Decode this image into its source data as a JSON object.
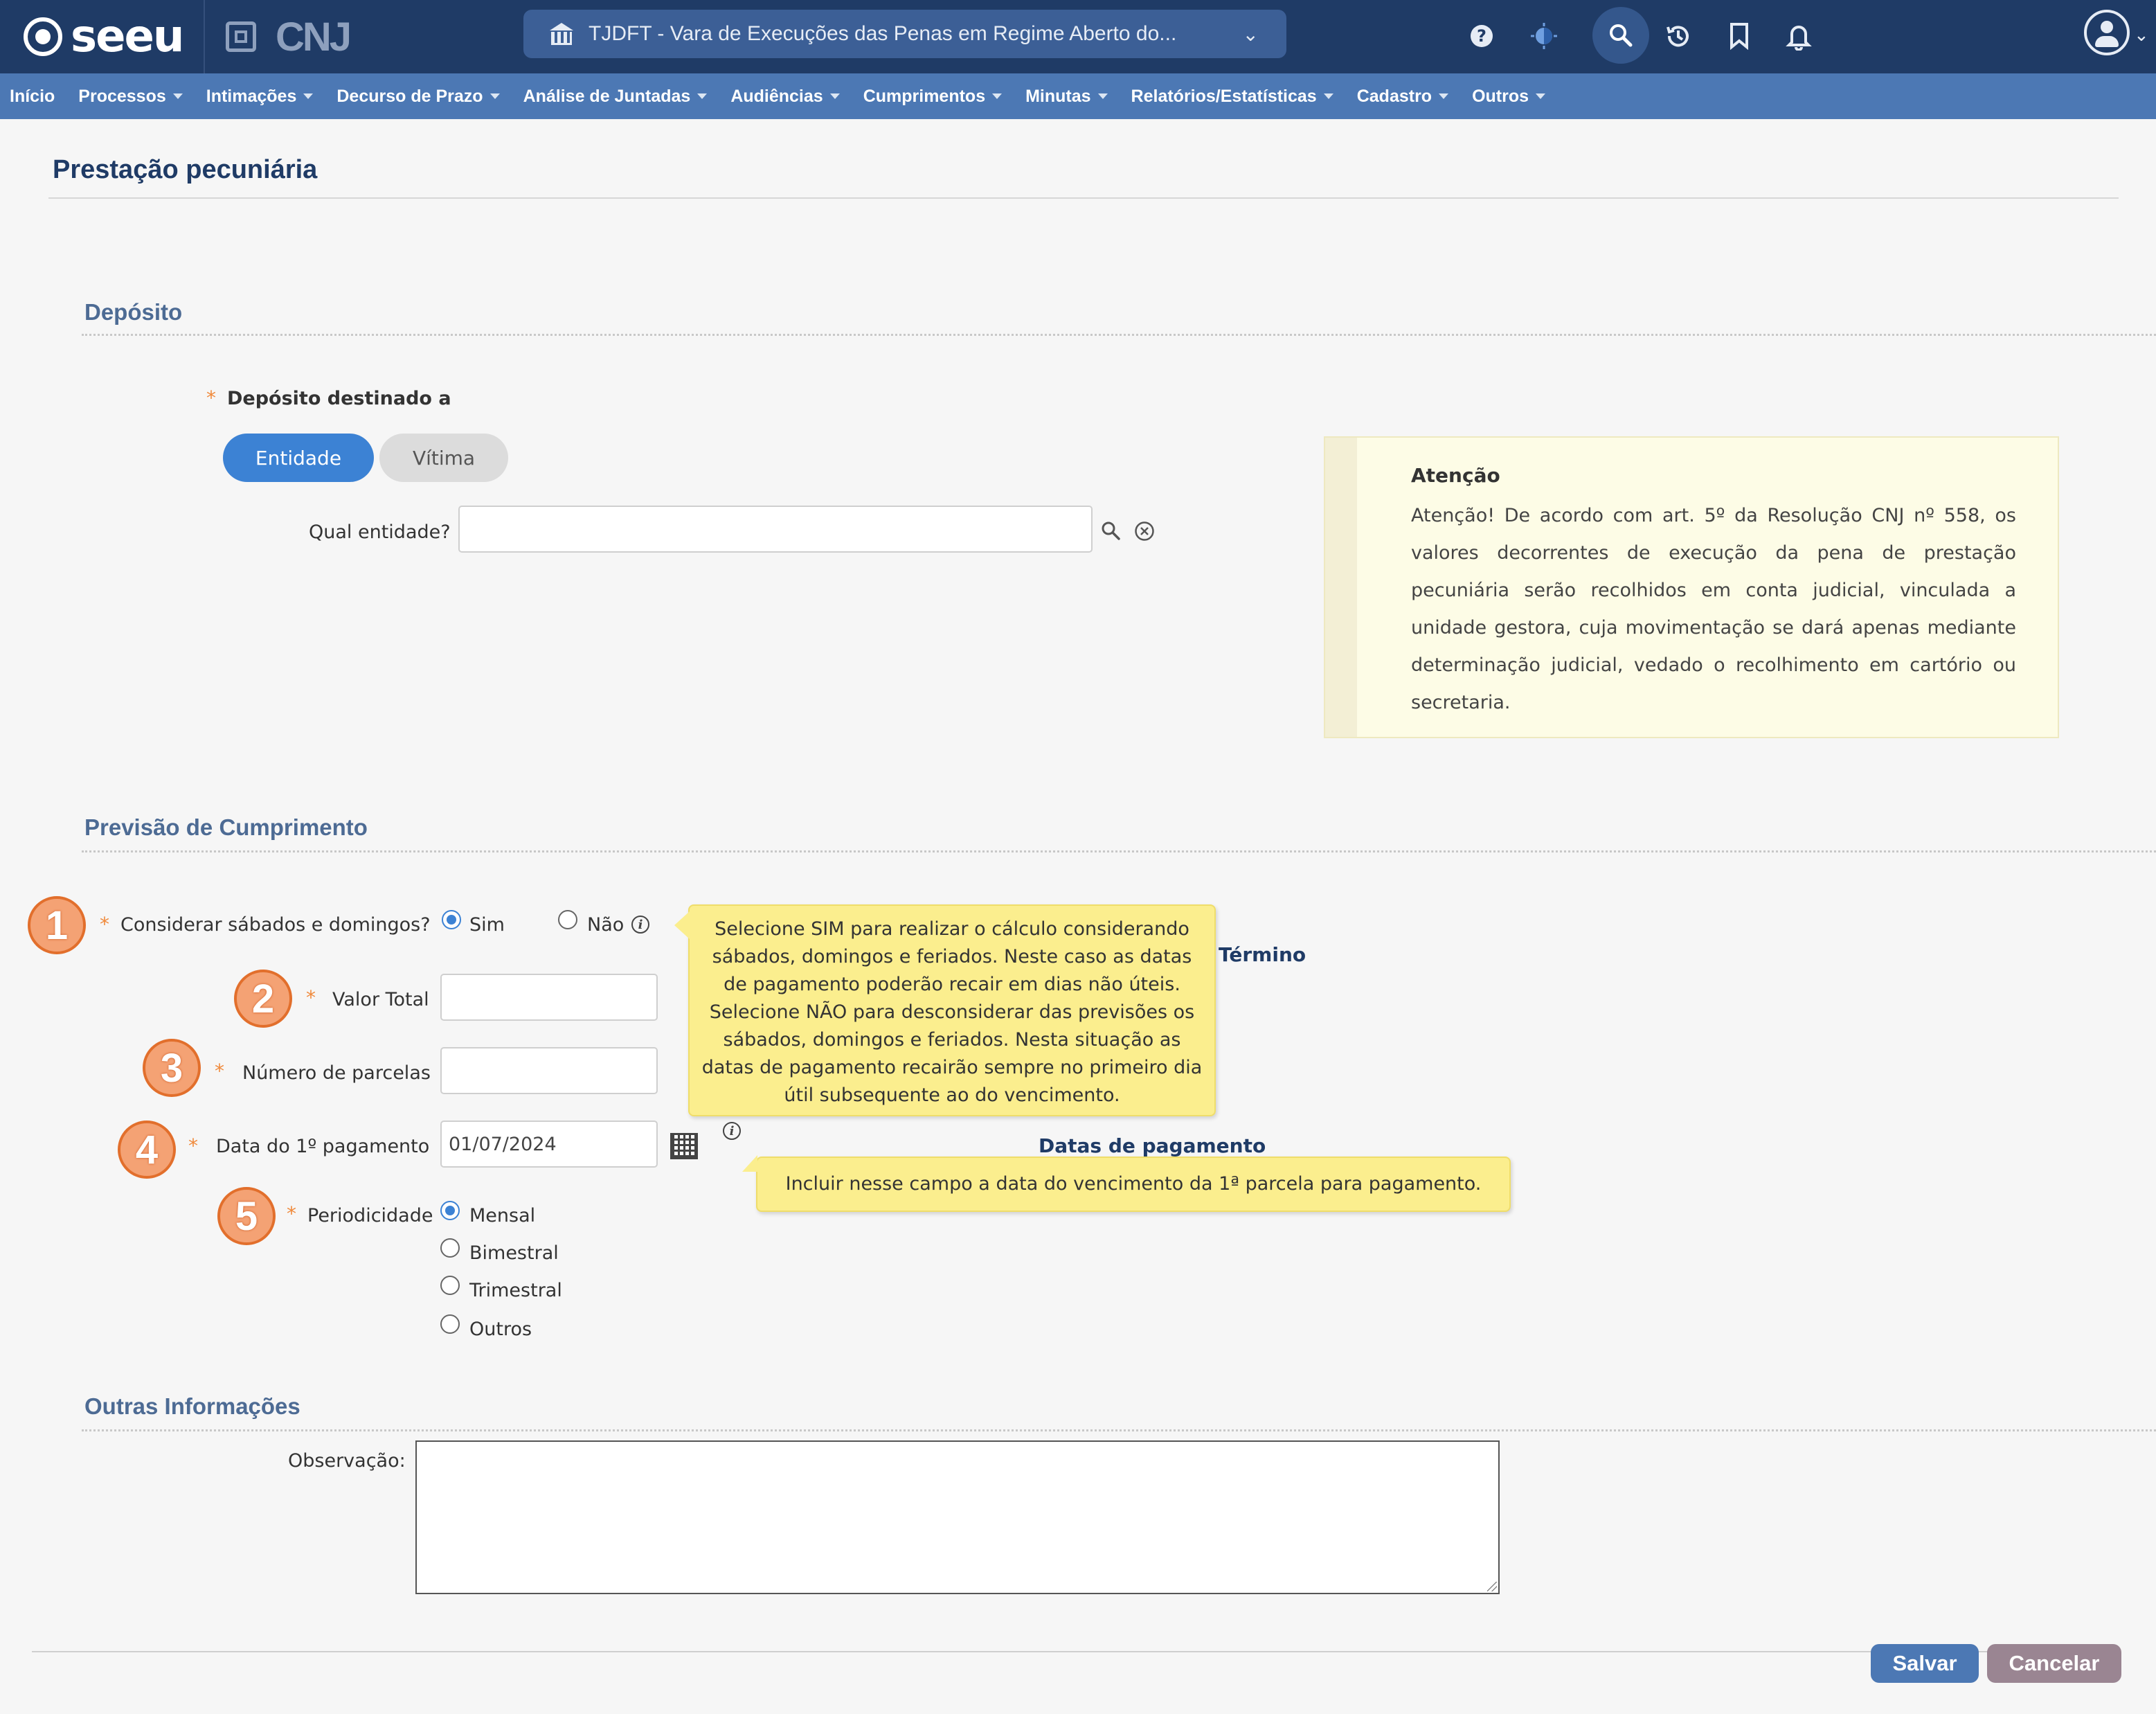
{
  "topbar": {
    "logo_text": "seeu",
    "cnj_text": "CNJ",
    "court_selector": "TJDFT - Vara de Execuções das Penas em Regime Aberto do...",
    "icons": [
      "help-icon",
      "theme-icon",
      "search-icon",
      "history-icon",
      "bookmark-icon",
      "notifications-icon",
      "user-icon"
    ]
  },
  "menu": [
    {
      "label": "Início",
      "dropdown": false
    },
    {
      "label": "Processos",
      "dropdown": true
    },
    {
      "label": "Intimações",
      "dropdown": true
    },
    {
      "label": "Decurso de Prazo",
      "dropdown": true
    },
    {
      "label": "Análise de Juntadas",
      "dropdown": true
    },
    {
      "label": "Audiências",
      "dropdown": true
    },
    {
      "label": "Cumprimentos",
      "dropdown": true
    },
    {
      "label": "Minutas",
      "dropdown": true
    },
    {
      "label": "Relatórios/Estatísticas",
      "dropdown": true
    },
    {
      "label": "Cadastro",
      "dropdown": true
    },
    {
      "label": "Outros",
      "dropdown": true
    }
  ],
  "page": {
    "title": "Prestação pecuniária"
  },
  "deposito": {
    "section_title": "Depósito",
    "required_mark": "*",
    "destinado_label": "Depósito destinado a",
    "options": {
      "entidade": "Entidade",
      "vitima": "Vítima"
    },
    "selected": "Entidade",
    "entidade_label": "Qual entidade?",
    "entidade_value": ""
  },
  "attention": {
    "title": "Atenção",
    "body": "Atenção! De acordo com art. 5º da Resolução CNJ nº 558, os valores decorrentes de execução da pena de prestação pecuniária serão recolhidos em conta judicial, vinculada a unidade gestora, cuja movimentação se dará apenas mediante determinação judicial, vedado o recolhimento em cartório ou secretaria."
  },
  "previsao": {
    "section_title": "Previsão de Cumprimento",
    "steps": [
      "1",
      "2",
      "3",
      "4",
      "5"
    ],
    "considerar_label": "Considerar sábados e domingos?",
    "sim_label": "Sim",
    "nao_label": "Não",
    "considerar_selected": "Sim",
    "valor_total_label": "Valor Total",
    "valor_total_value": "",
    "parcelas_label": "Número de parcelas",
    "parcelas_value": "",
    "data_label": "Data do 1º pagamento",
    "data_value": "01/07/2024",
    "periodicidade_label": "Periodicidade",
    "periodicidade_options": [
      "Mensal",
      "Bimestral",
      "Trimestral",
      "Outros"
    ],
    "periodicidade_selected": "Mensal",
    "termino_label": "Término",
    "datas_pagamento_label": "Datas de pagamento",
    "tooltip_weekend": "Selecione SIM para realizar o cálculo considerando sábados, domingos e feriados. Neste caso as datas de pagamento poderão recair em dias não úteis. Selecione NÃO para desconsiderar das previsões os sábados, domingos e feriados. Nesta situação as datas de pagamento recairão sempre no primeiro dia útil subsequente ao do vencimento.",
    "tooltip_weekend_lines": [
      "Selecione SIM para realizar o cálculo considerando",
      "sábados, domingos e feriados. Neste caso as datas",
      "de pagamento poderão recair em dias não úteis.",
      "Selecione NÃO para desconsiderar das previsões os",
      "sábados, domingos e feriados. Nesta situação as",
      "datas de pagamento recairão sempre no primeiro dia",
      "útil subsequente ao do vencimento."
    ],
    "tooltip_date": "Incluir nesse campo a data do vencimento da 1ª parcela para pagamento."
  },
  "outras": {
    "section_title": "Outras Informações",
    "observacao_label": "Observação:",
    "observacao_value": ""
  },
  "actions": {
    "save": "Salvar",
    "cancel": "Cancelar"
  },
  "colors": {
    "topbar": "#1f3b66",
    "menubar": "#4c78b4",
    "primary": "#3c82d4",
    "badge": "#f4a274",
    "tooltip": "#fbee8e",
    "cancel": "#9a8592"
  }
}
